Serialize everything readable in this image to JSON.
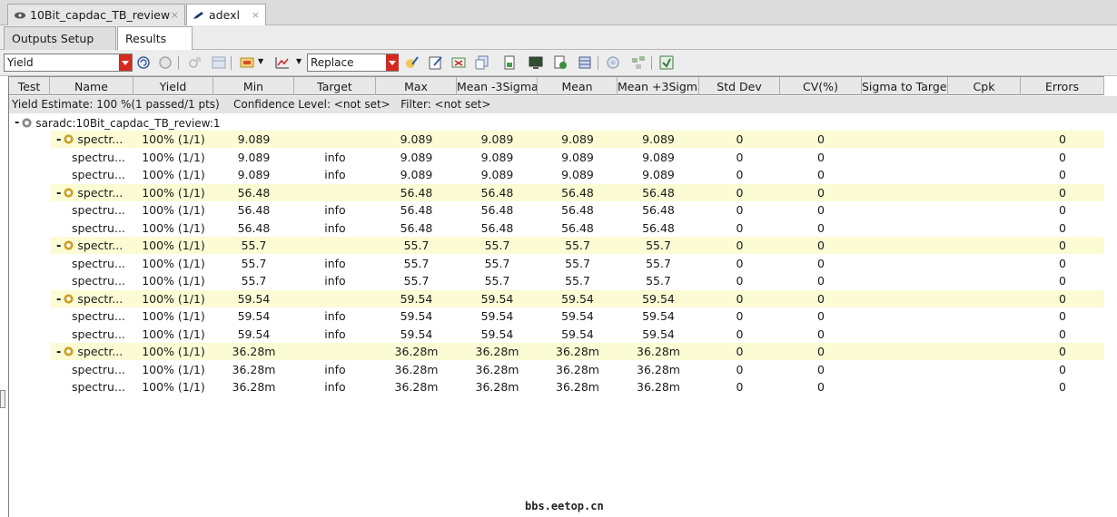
{
  "doc_tabs": [
    {
      "label": "10Bit_capdac_TB_review",
      "close": "×"
    },
    {
      "label": "adexl",
      "close": "×"
    }
  ],
  "sub_tabs": [
    {
      "label": "Outputs Setup"
    },
    {
      "label": "Results"
    }
  ],
  "toolbar": {
    "view_select": "Yield",
    "replace_select": "Replace",
    "icons": [
      "refresh-icon",
      "stop-icon",
      "plot-settings-icon",
      "table-icon",
      "annotate-icon",
      "plot-icon",
      "edit-target-icon",
      "edit-spec-icon",
      "compare-icon",
      "export-icon",
      "print-icon",
      "monitor-icon",
      "reload-icon",
      "database-icon",
      "stop-circle-icon",
      "network-icon",
      "spreadsheet-icon"
    ]
  },
  "columns": [
    "Test",
    "Name",
    "Yield",
    "Min",
    "Target",
    "Max",
    "Mean -3Sigma",
    "Mean",
    "Mean +3Sigma",
    "Std Dev",
    "CV(%)",
    "Sigma to Target",
    "Cpk",
    "Errors"
  ],
  "estimate": {
    "text": "Yield Estimate: 100 %(1 passed/1 pts)    Confidence Level: <not set>   Filter: <not set>"
  },
  "root": {
    "label": "saradc:10Bit_capdac_TB_review:1"
  },
  "rows": [
    {
      "group": true,
      "name": "spectr...",
      "yield": "100% (1/1)",
      "min": "9.089",
      "target": "",
      "max": "9.089",
      "m3": "9.089",
      "mean": "9.089",
      "p3": "9.089",
      "std": "0",
      "cv": "0",
      "errors": "0"
    },
    {
      "group": false,
      "name": "spectru...",
      "yield": "100% (1/1)",
      "min": "9.089",
      "target": "info",
      "max": "9.089",
      "m3": "9.089",
      "mean": "9.089",
      "p3": "9.089",
      "std": "0",
      "cv": "0",
      "errors": "0"
    },
    {
      "group": false,
      "name": "spectru...",
      "yield": "100% (1/1)",
      "min": "9.089",
      "target": "info",
      "max": "9.089",
      "m3": "9.089",
      "mean": "9.089",
      "p3": "9.089",
      "std": "0",
      "cv": "0",
      "errors": "0"
    },
    {
      "group": true,
      "name": "spectr...",
      "yield": "100% (1/1)",
      "min": "56.48",
      "target": "",
      "max": "56.48",
      "m3": "56.48",
      "mean": "56.48",
      "p3": "56.48",
      "std": "0",
      "cv": "0",
      "errors": "0"
    },
    {
      "group": false,
      "name": "spectru...",
      "yield": "100% (1/1)",
      "min": "56.48",
      "target": "info",
      "max": "56.48",
      "m3": "56.48",
      "mean": "56.48",
      "p3": "56.48",
      "std": "0",
      "cv": "0",
      "errors": "0"
    },
    {
      "group": false,
      "name": "spectru...",
      "yield": "100% (1/1)",
      "min": "56.48",
      "target": "info",
      "max": "56.48",
      "m3": "56.48",
      "mean": "56.48",
      "p3": "56.48",
      "std": "0",
      "cv": "0",
      "errors": "0"
    },
    {
      "group": true,
      "name": "spectr...",
      "yield": "100% (1/1)",
      "min": "55.7",
      "target": "",
      "max": "55.7",
      "m3": "55.7",
      "mean": "55.7",
      "p3": "55.7",
      "std": "0",
      "cv": "0",
      "errors": "0"
    },
    {
      "group": false,
      "name": "spectru...",
      "yield": "100% (1/1)",
      "min": "55.7",
      "target": "info",
      "max": "55.7",
      "m3": "55.7",
      "mean": "55.7",
      "p3": "55.7",
      "std": "0",
      "cv": "0",
      "errors": "0"
    },
    {
      "group": false,
      "name": "spectru...",
      "yield": "100% (1/1)",
      "min": "55.7",
      "target": "info",
      "max": "55.7",
      "m3": "55.7",
      "mean": "55.7",
      "p3": "55.7",
      "std": "0",
      "cv": "0",
      "errors": "0"
    },
    {
      "group": true,
      "name": "spectr...",
      "yield": "100% (1/1)",
      "min": "59.54",
      "target": "",
      "max": "59.54",
      "m3": "59.54",
      "mean": "59.54",
      "p3": "59.54",
      "std": "0",
      "cv": "0",
      "errors": "0"
    },
    {
      "group": false,
      "name": "spectru...",
      "yield": "100% (1/1)",
      "min": "59.54",
      "target": "info",
      "max": "59.54",
      "m3": "59.54",
      "mean": "59.54",
      "p3": "59.54",
      "std": "0",
      "cv": "0",
      "errors": "0"
    },
    {
      "group": false,
      "name": "spectru...",
      "yield": "100% (1/1)",
      "min": "59.54",
      "target": "info",
      "max": "59.54",
      "m3": "59.54",
      "mean": "59.54",
      "p3": "59.54",
      "std": "0",
      "cv": "0",
      "errors": "0"
    },
    {
      "group": true,
      "name": "spectr...",
      "yield": "100% (1/1)",
      "min": "36.28m",
      "target": "",
      "max": "36.28m",
      "m3": "36.28m",
      "mean": "36.28m",
      "p3": "36.28m",
      "std": "0",
      "cv": "0",
      "errors": "0"
    },
    {
      "group": false,
      "name": "spectru...",
      "yield": "100% (1/1)",
      "min": "36.28m",
      "target": "info",
      "max": "36.28m",
      "m3": "36.28m",
      "mean": "36.28m",
      "p3": "36.28m",
      "std": "0",
      "cv": "0",
      "errors": "0"
    },
    {
      "group": false,
      "name": "spectru...",
      "yield": "100% (1/1)",
      "min": "36.28m",
      "target": "info",
      "max": "36.28m",
      "m3": "36.28m",
      "mean": "36.28m",
      "p3": "36.28m",
      "std": "0",
      "cv": "0",
      "errors": "0"
    }
  ],
  "watermark": "bbs.eetop.cn",
  "colors": {
    "group_row": "#fbfbd4",
    "dropdown": "#d42a1e"
  }
}
